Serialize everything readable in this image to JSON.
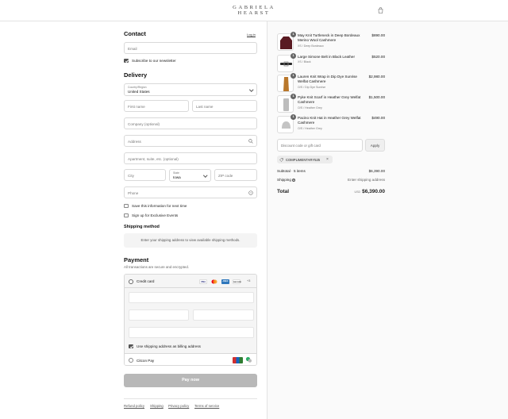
{
  "brand": {
    "line1": "GABRIELA",
    "line2": "HEARST"
  },
  "header": {
    "cart_icon": "shopping-bag-icon"
  },
  "contact": {
    "heading": "Contact",
    "login_link": "Log in",
    "email_placeholder": "Email",
    "newsletter_label": "Subscribe to our newsletter",
    "newsletter_checked": true
  },
  "delivery": {
    "heading": "Delivery",
    "country_label": "Country/Region",
    "country_value": "United States",
    "first_name_placeholder": "First name",
    "last_name_placeholder": "Last name",
    "company_placeholder": "Company (optional)",
    "address_placeholder": "Address",
    "apartment_placeholder": "Apartment, suite, etc. (optional)",
    "city_placeholder": "City",
    "state_label": "State",
    "state_value": "Iowa",
    "zip_placeholder": "ZIP code",
    "phone_placeholder": "Phone",
    "save_info_label": "Save this information for next time",
    "exclusive_events_label": "Sign up for Exclusive Events"
  },
  "shipping": {
    "heading": "Shipping method",
    "notice": "Enter your shipping address to view available shipping methods."
  },
  "payment": {
    "heading": "Payment",
    "subtitle": "All transactions are secure and encrypted.",
    "credit_card_label": "Credit card",
    "card_brands": [
      "VISA",
      "MC",
      "AMEX",
      "DISCOVER"
    ],
    "more_cards": "+3",
    "billing_same_label": "Use shipping address as billing address",
    "billing_same_checked": true,
    "citcon_label": "Citcon Pay",
    "pay_button": "Pay now"
  },
  "footer": {
    "links": [
      "Refund policy",
      "Shipping",
      "Privacy policy",
      "Terms of service"
    ]
  },
  "order": {
    "items": [
      {
        "name": "May Knit Turtleneck in Deep Bordeaux Merino Wool Cashmere",
        "variant": "XS / Deep Bordeaux",
        "price": "$890.00",
        "qty": "1",
        "color": "#5a1a22"
      },
      {
        "name": "Large Simone Belt in Black Leather",
        "variant": "XS / Black",
        "price": "$520.00",
        "qty": "1",
        "color": "#2a2a2a"
      },
      {
        "name": "Lauren Knit Wrap in Dip Dye Sunrise Welfat Cashmere",
        "variant": "O/S / Dip Dye Sunrise",
        "price": "$2,980.00",
        "qty": "1",
        "color": "#b9772a"
      },
      {
        "name": "Pyke Knit Scarf in Heather Grey Welfat Cashmere",
        "variant": "O/S / Heather Grey",
        "price": "$1,500.00",
        "qty": "1",
        "color": "#bdbdbd"
      },
      {
        "name": "Pacino Knit Hat in Heather Grey Welfat Cashmere",
        "variant": "O/S / Heather Grey",
        "price": "$490.00",
        "qty": "1",
        "color": "#c4c4c4"
      }
    ],
    "discount_placeholder": "Discount code or gift card",
    "apply_button": "Apply",
    "applied_code": "COMPLIMENTARY525",
    "subtotal_label": "Subtotal · 5 items",
    "subtotal_value": "$6,390.00",
    "shipping_label": "Shipping",
    "shipping_value": "Enter shipping address",
    "total_label": "Total",
    "total_currency": "USD",
    "total_value": "$6,390.00"
  }
}
